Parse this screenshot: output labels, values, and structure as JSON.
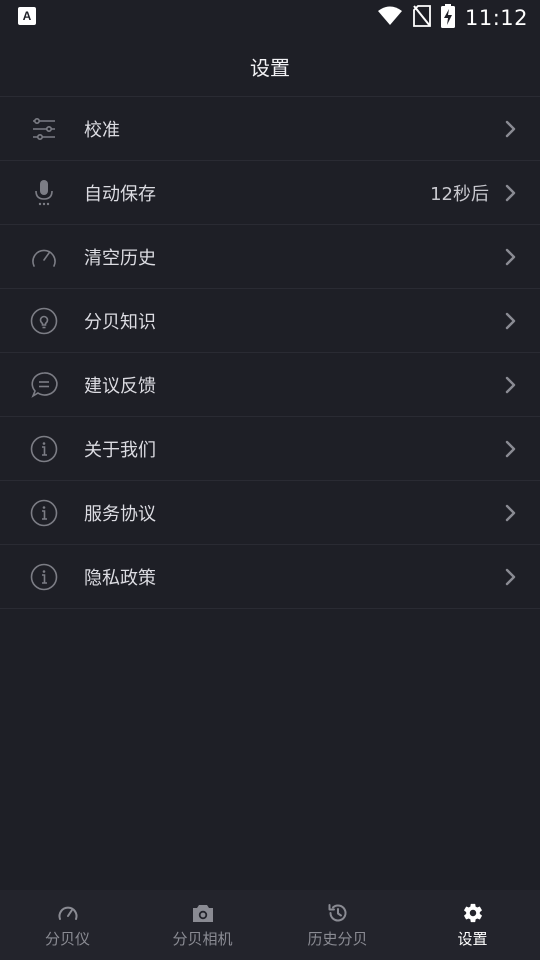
{
  "status_bar": {
    "time": "11:12",
    "app_badge_letter": "A"
  },
  "header": {
    "title": "设置"
  },
  "settings": {
    "items": [
      {
        "label": "校准",
        "value": "",
        "icon": "sliders-icon"
      },
      {
        "label": "自动保存",
        "value": "12秒后",
        "icon": "microphone-icon"
      },
      {
        "label": "清空历史",
        "value": "",
        "icon": "speedometer-icon"
      },
      {
        "label": "分贝知识",
        "value": "",
        "icon": "lightbulb-icon"
      },
      {
        "label": "建议反馈",
        "value": "",
        "icon": "chat-bubble-icon"
      },
      {
        "label": "关于我们",
        "value": "",
        "icon": "info-icon"
      },
      {
        "label": "服务协议",
        "value": "",
        "icon": "info-icon"
      },
      {
        "label": "隐私政策",
        "value": "",
        "icon": "info-icon"
      }
    ]
  },
  "tab_bar": {
    "tabs": [
      {
        "label": "分贝仪",
        "icon": "gauge-icon",
        "active": false
      },
      {
        "label": "分贝相机",
        "icon": "camera-icon",
        "active": false
      },
      {
        "label": "历史分贝",
        "icon": "history-icon",
        "active": false
      },
      {
        "label": "设置",
        "icon": "gear-icon",
        "active": true
      }
    ]
  },
  "colors": {
    "background": "#1e1f26",
    "divider": "#2a2b33",
    "tab_bar_bg": "#23242c",
    "text_primary": "#dcdce2",
    "text_inactive": "#8a8b93",
    "icon_gray": "#7c7d85"
  }
}
